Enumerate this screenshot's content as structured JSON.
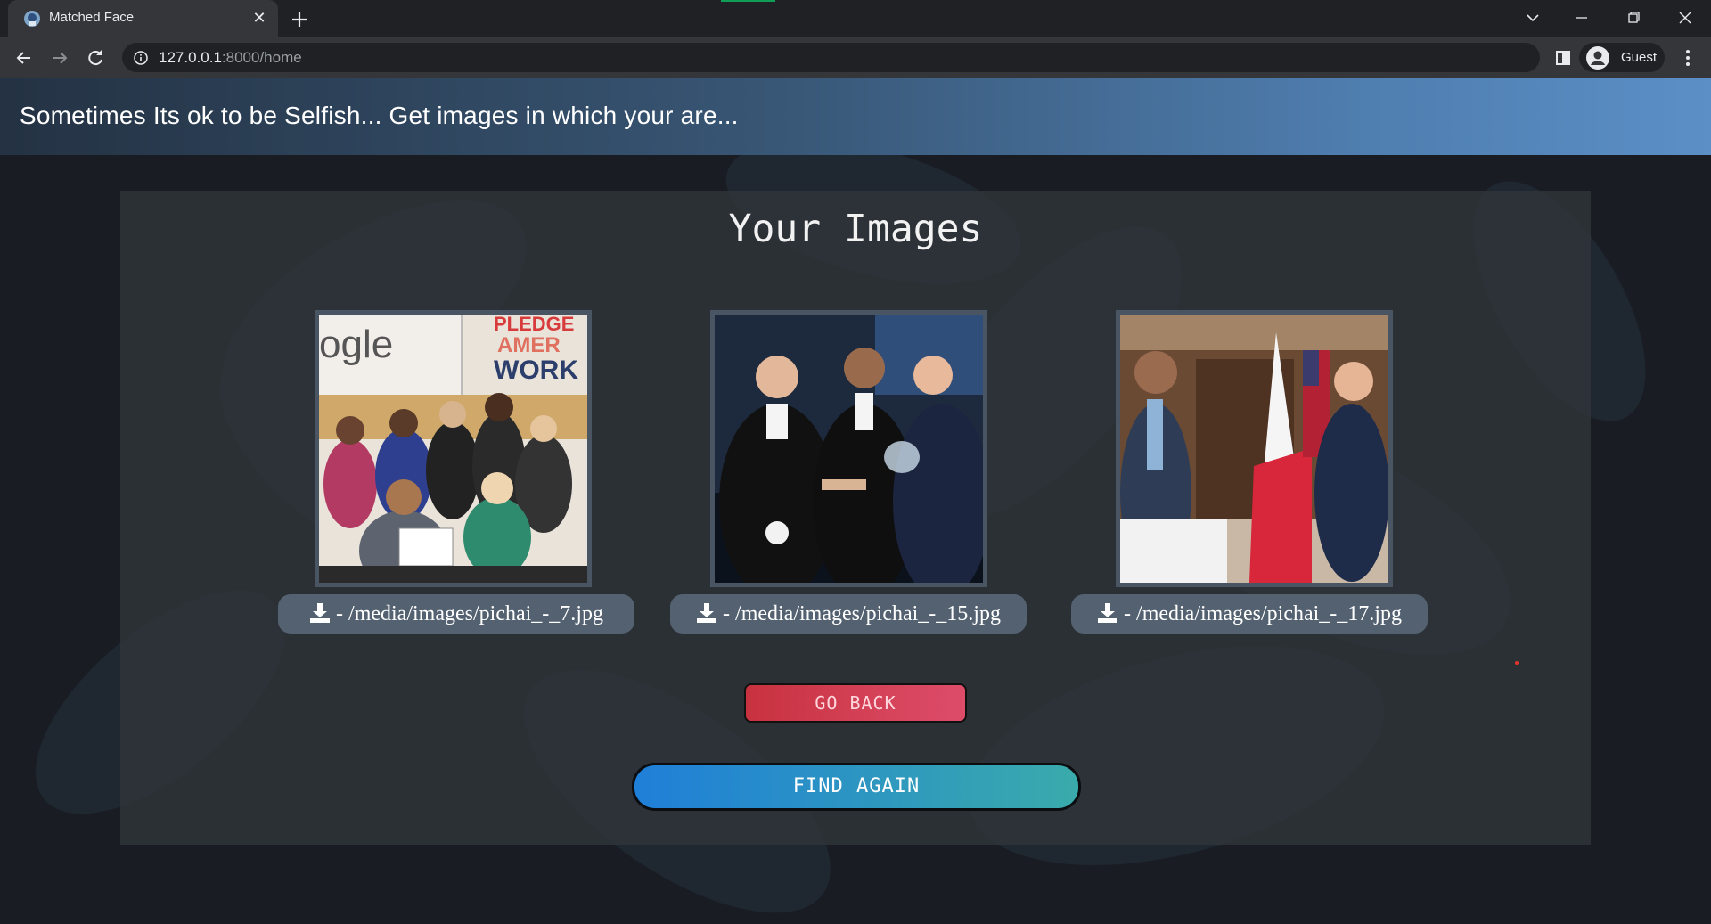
{
  "browser": {
    "tab_title": "Matched Face",
    "tab_close": "✕",
    "url_host": "127.0.0.1",
    "url_path": ":8000/home",
    "profile_label": "Guest"
  },
  "header": {
    "text": "Sometimes Its ok to be Selfish... Get images in which your are..."
  },
  "main": {
    "title": "Your Images",
    "images": [
      {
        "label": "- /media/images/pichai_-_7.jpg"
      },
      {
        "label": "- /media/images/pichai_-_15.jpg"
      },
      {
        "label": "- /media/images/pichai_-_17.jpg"
      }
    ],
    "go_back_label": "GO BACK",
    "find_again_label": "FIND AGAIN"
  },
  "photo1": {
    "sign_word": "ogle",
    "sign_lines": [
      "PLEDGE",
      "AMER",
      "WORK"
    ]
  },
  "colors": {
    "header_gradient_start": "#243243",
    "header_gradient_end": "#5b8fc6",
    "go_back": "#c8323f",
    "find_again_start": "#1f7fd8",
    "find_again_end": "#3aabab",
    "download_pill": "#536170"
  },
  "icons": {
    "download": "download-icon",
    "reload": "reload-icon",
    "back": "arrow-left-icon",
    "forward": "arrow-right-icon"
  }
}
